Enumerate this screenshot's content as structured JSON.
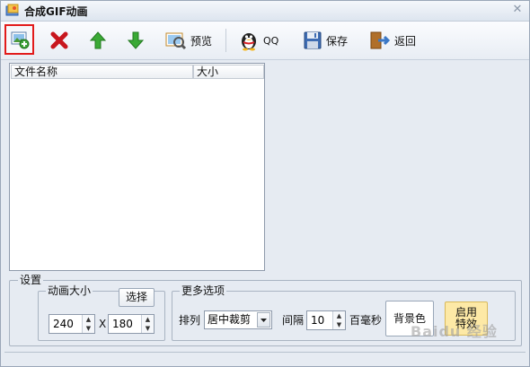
{
  "window": {
    "title": "合成GIF动画",
    "close_glyph": "✕"
  },
  "toolbar": {
    "add_icon": "add-image-icon",
    "delete_icon": "red-x-delete-icon",
    "up_icon": "green-up-arrow-icon",
    "down_icon": "green-down-arrow-icon",
    "preview_label": "预览",
    "qq_label": "QQ",
    "save_label": "保存",
    "back_label": "返回"
  },
  "file_list": {
    "columns": [
      "文件名称",
      "大小"
    ],
    "rows": []
  },
  "settings": {
    "legend": "设置",
    "size_group": {
      "legend": "动画大小",
      "choose_label": "选择",
      "width": "240",
      "x_label": "X",
      "height": "180"
    },
    "more_group": {
      "legend": "更多选项",
      "arrange_label": "排列",
      "arrange_value": "居中裁剪",
      "interval_label": "间隔",
      "interval_value": "10",
      "unit_label": "百毫秒",
      "bgcolor_label": "背景色",
      "effect_label_1": "启用",
      "effect_label_2": "特效"
    }
  },
  "watermark": "Baidu 经验",
  "colors": {
    "highlight": "#e21b1b",
    "window_bg": "#e6ebf2",
    "effect_bg": "#fde9a6"
  }
}
